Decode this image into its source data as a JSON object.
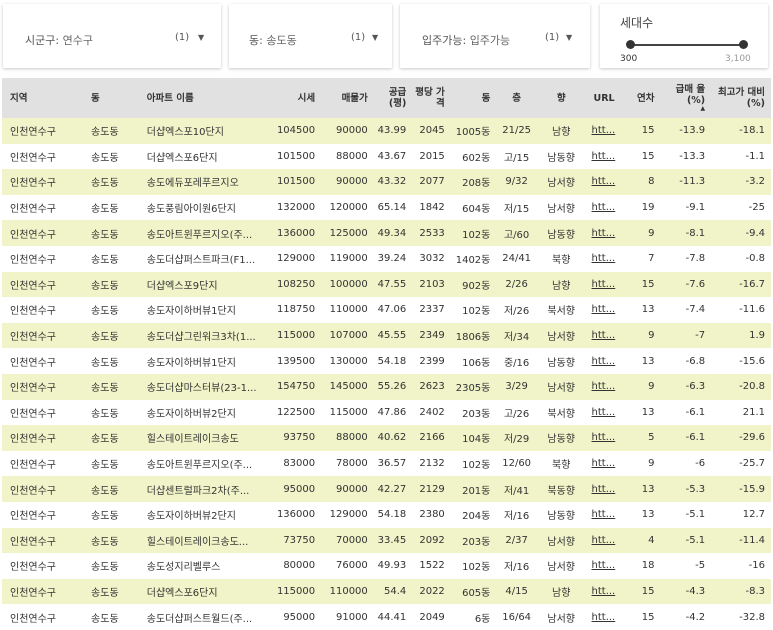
{
  "filters": {
    "sigungu": {
      "label": "시군구",
      "value": "연수구",
      "count": "(1)"
    },
    "dong": {
      "label": "동",
      "value": "송도동",
      "count": "(1)"
    },
    "ipju": {
      "label": "입주가능",
      "value": "입주가능",
      "count": "(1)"
    },
    "households": {
      "title": "세대수",
      "min": "300",
      "max": "3,100"
    }
  },
  "table": {
    "headers": [
      "지역",
      "동",
      "아파트 이름",
      "시세",
      "매물가",
      "공급 (평)",
      "평당 가격",
      "동",
      "층",
      "향",
      "URL",
      "연차",
      "급매 율(%)",
      "최고가 대비(%)"
    ],
    "rows": [
      [
        "인천연수구",
        "송도동",
        "더샵엑스포10단지",
        "104500",
        "90000",
        "43.99",
        "2045",
        "1005동",
        "21/25",
        "남향",
        "htt...",
        "15",
        "-13.9",
        "-18.1"
      ],
      [
        "인천연수구",
        "송도동",
        "더샵엑스포6단지",
        "101500",
        "88000",
        "43.67",
        "2015",
        "602동",
        "고/15",
        "남동향",
        "htt...",
        "15",
        "-13.3",
        "-1.1"
      ],
      [
        "인천연수구",
        "송도동",
        "송도에듀포레푸르지오",
        "101500",
        "90000",
        "43.32",
        "2077",
        "208동",
        "9/32",
        "남서향",
        "htt...",
        "8",
        "-11.3",
        "-3.2"
      ],
      [
        "인천연수구",
        "송도동",
        "송도풍림아이원6단지",
        "132000",
        "120000",
        "65.14",
        "1842",
        "604동",
        "저/15",
        "남서향",
        "htt...",
        "19",
        "-9.1",
        "-25"
      ],
      [
        "인천연수구",
        "송도동",
        "송도아트윈푸르지오(주...",
        "136000",
        "125000",
        "49.34",
        "2533",
        "102동",
        "고/60",
        "남동향",
        "htt...",
        "9",
        "-8.1",
        "-9.4"
      ],
      [
        "인천연수구",
        "송도동",
        "송도더샵퍼스트파크(F1...",
        "129000",
        "119000",
        "39.24",
        "3032",
        "1402동",
        "24/41",
        "북향",
        "htt...",
        "7",
        "-7.8",
        "-0.8"
      ],
      [
        "인천연수구",
        "송도동",
        "더샵엑스포9단지",
        "108250",
        "100000",
        "47.55",
        "2103",
        "902동",
        "2/26",
        "남향",
        "htt...",
        "15",
        "-7.6",
        "-16.7"
      ],
      [
        "인천연수구",
        "송도동",
        "송도자이하버뷰1단지",
        "118750",
        "110000",
        "47.06",
        "2337",
        "102동",
        "저/26",
        "북서향",
        "htt...",
        "13",
        "-7.4",
        "-11.6"
      ],
      [
        "인천연수구",
        "송도동",
        "송도더샵그린워크3차(1...",
        "115000",
        "107000",
        "45.55",
        "2349",
        "1806동",
        "저/34",
        "남서향",
        "htt...",
        "9",
        "-7",
        "1.9"
      ],
      [
        "인천연수구",
        "송도동",
        "송도자이하버뷰1단지",
        "139500",
        "130000",
        "54.18",
        "2399",
        "106동",
        "중/16",
        "남동향",
        "htt...",
        "13",
        "-6.8",
        "-15.6"
      ],
      [
        "인천연수구",
        "송도동",
        "송도더샵마스터뷰(23-1...",
        "154750",
        "145000",
        "55.26",
        "2623",
        "2305동",
        "3/29",
        "남서향",
        "htt...",
        "9",
        "-6.3",
        "-20.8"
      ],
      [
        "인천연수구",
        "송도동",
        "송도자이하버뷰2단지",
        "122500",
        "115000",
        "47.86",
        "2402",
        "203동",
        "고/26",
        "북서향",
        "htt...",
        "13",
        "-6.1",
        "21.1"
      ],
      [
        "인천연수구",
        "송도동",
        "힐스테이트레이크송도",
        "93750",
        "88000",
        "40.62",
        "2166",
        "104동",
        "저/29",
        "남동향",
        "htt...",
        "5",
        "-6.1",
        "-29.6"
      ],
      [
        "인천연수구",
        "송도동",
        "송도아트윈푸르지오(주...",
        "83000",
        "78000",
        "36.57",
        "2132",
        "102동",
        "12/60",
        "북향",
        "htt...",
        "9",
        "-6",
        "-25.7"
      ],
      [
        "인천연수구",
        "송도동",
        "더샵센트럴파크2차(주...",
        "95000",
        "90000",
        "42.27",
        "2129",
        "201동",
        "저/41",
        "북동향",
        "htt...",
        "13",
        "-5.3",
        "-15.9"
      ],
      [
        "인천연수구",
        "송도동",
        "송도자이하버뷰2단지",
        "136000",
        "129000",
        "54.18",
        "2380",
        "204동",
        "저/16",
        "남동향",
        "htt...",
        "13",
        "-5.1",
        "12.7"
      ],
      [
        "인천연수구",
        "송도동",
        "힐스테이트레이크송도...",
        "73750",
        "70000",
        "33.45",
        "2092",
        "203동",
        "2/37",
        "남서향",
        "htt...",
        "4",
        "-5.1",
        "-11.4"
      ],
      [
        "인천연수구",
        "송도동",
        "송도성지리벨루스",
        "80000",
        "76000",
        "49.93",
        "1522",
        "102동",
        "저/16",
        "남서향",
        "htt...",
        "18",
        "-5",
        "-16"
      ],
      [
        "인천연수구",
        "송도동",
        "더샵엑스포6단지",
        "115000",
        "110000",
        "54.4",
        "2022",
        "605동",
        "4/15",
        "남향",
        "htt...",
        "15",
        "-4.3",
        "-8.3"
      ],
      [
        "인천연수구",
        "송도동",
        "송도더샵퍼스트월드(주...",
        "95000",
        "91000",
        "44.41",
        "2049",
        "6동",
        "16/64",
        "남서향",
        "htt...",
        "15",
        "-4.2",
        "-32.8"
      ]
    ]
  }
}
